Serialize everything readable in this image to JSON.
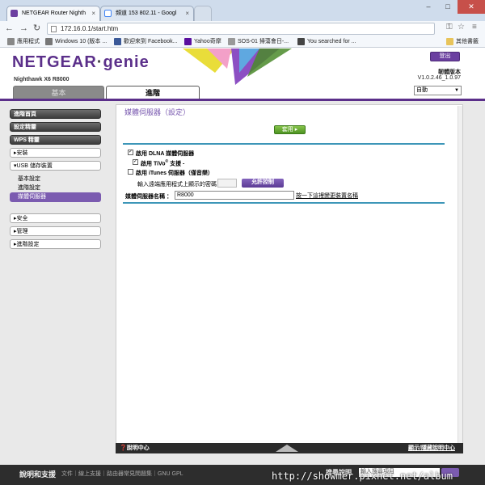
{
  "browser": {
    "tabs": [
      {
        "title": "NETGEAR Router Nighth",
        "active": true
      },
      {
        "title": "頻道 153 802.11 - Googl",
        "active": false
      }
    ],
    "url": "172.16.0.1/start.htm",
    "bookmarks": [
      "應用程式",
      "Windows 10 (版本 ...",
      "歡迎來到 Facebook...",
      "Yahoo奇摩",
      "SOS-01 掃蕩會日-...",
      "You searched for ...",
      "其他書籤"
    ],
    "colors": {
      "strip": "#cfdcec",
      "close": "#c7504a"
    }
  },
  "header": {
    "brand": "NETGEAR",
    "brand_suffix": "genie",
    "model": "Nighthawk X6 R8000",
    "logout": "登出",
    "firmware_label": "韌體版本",
    "firmware_version": "V1.0.2.46_1.0.97",
    "language": "自動",
    "tabs": {
      "basic": "基本",
      "advanced": "進階"
    },
    "accent": "#5b2f8a"
  },
  "sidebar": {
    "items": [
      {
        "label": "進階首頁",
        "style": "dark"
      },
      {
        "label": "設定精靈",
        "style": "dark"
      },
      {
        "label": "WPS 精靈",
        "style": "dark"
      },
      {
        "label": "▸安裝",
        "style": "light"
      },
      {
        "label": "▾USB 儲存裝置",
        "style": "light"
      },
      {
        "label": "基本設定",
        "style": "sub"
      },
      {
        "label": "進階設定",
        "style": "sub"
      },
      {
        "label": "媒體伺服器",
        "style": "sel"
      },
      {
        "label": "▸安全",
        "style": "light"
      },
      {
        "label": "▸管理",
        "style": "light"
      },
      {
        "label": "▸進階設定",
        "style": "light"
      }
    ]
  },
  "content": {
    "title": "媒體伺服器（設定）",
    "apply": "套用 ▸",
    "dlna_label": "啟用 DLNA 媒體伺服器",
    "dlna_checked": true,
    "tivo_label_a": "啟用 TiVo",
    "tivo_sup": "®",
    "tivo_label_b": " 支援 -",
    "tivo_checked": true,
    "itunes_label": "啟用 iTunes 伺服器（僅音樂）",
    "itunes_checked": false,
    "password_prompt": "輸入遠端應用程式上顯示的密碼",
    "allow_button": "允許控制",
    "server_name_label": "媒體伺服器名稱 ：",
    "server_name_value": "R8000",
    "server_name_link": "按一下這裡變更裝置名稱"
  },
  "helpbar": {
    "left": "❓說明中心",
    "right": "顯示/隱藏說明中心"
  },
  "footer": {
    "title": "說明和支援",
    "links": "文件｜線上支援｜路由器常見問題集｜GNU GPL",
    "search_label": "搜尋說明",
    "search_placeholder": "輸入搜尋項目"
  },
  "watermark": "http://showmer.pixnet.net/album"
}
